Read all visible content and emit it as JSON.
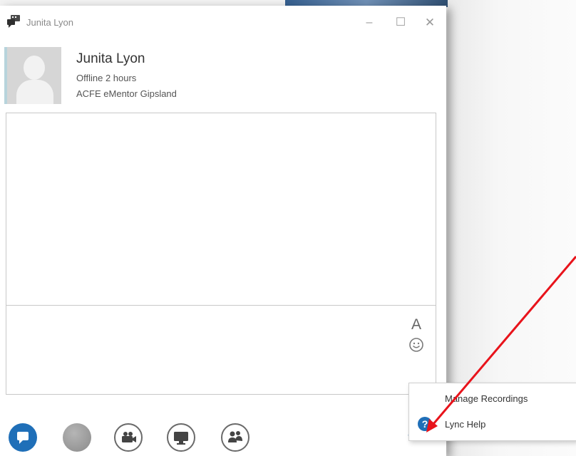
{
  "window": {
    "title": "Junita Lyon",
    "minimize_glyph": "–",
    "maximize_glyph": "☐",
    "close_glyph": "✕",
    "app_icon": "lync-conversation-icon"
  },
  "contact": {
    "name": "Junita Lyon",
    "status": "Offline 2 hours",
    "organization": "ACFE eMentor Gipsland",
    "avatar_icon": "default-person-avatar"
  },
  "compose": {
    "font_glyph": "A",
    "font_icon": "font-icon",
    "emoticon_icon": "emoticon-icon"
  },
  "bottombar": {
    "buttons": [
      {
        "name": "im-icon",
        "color": "#1f6fb8"
      },
      {
        "name": "audio-icon"
      },
      {
        "name": "video-icon"
      },
      {
        "name": "present-icon"
      },
      {
        "name": "participants-icon"
      }
    ],
    "more_glyph": "•••"
  },
  "menu": {
    "items": [
      {
        "label": "Manage Recordings"
      },
      {
        "label": "Lync Help",
        "icon": "help-icon",
        "icon_glyph": "?"
      }
    ]
  },
  "colors": {
    "accent": "#1f6fb8",
    "annotation_arrow": "#e8131b"
  }
}
